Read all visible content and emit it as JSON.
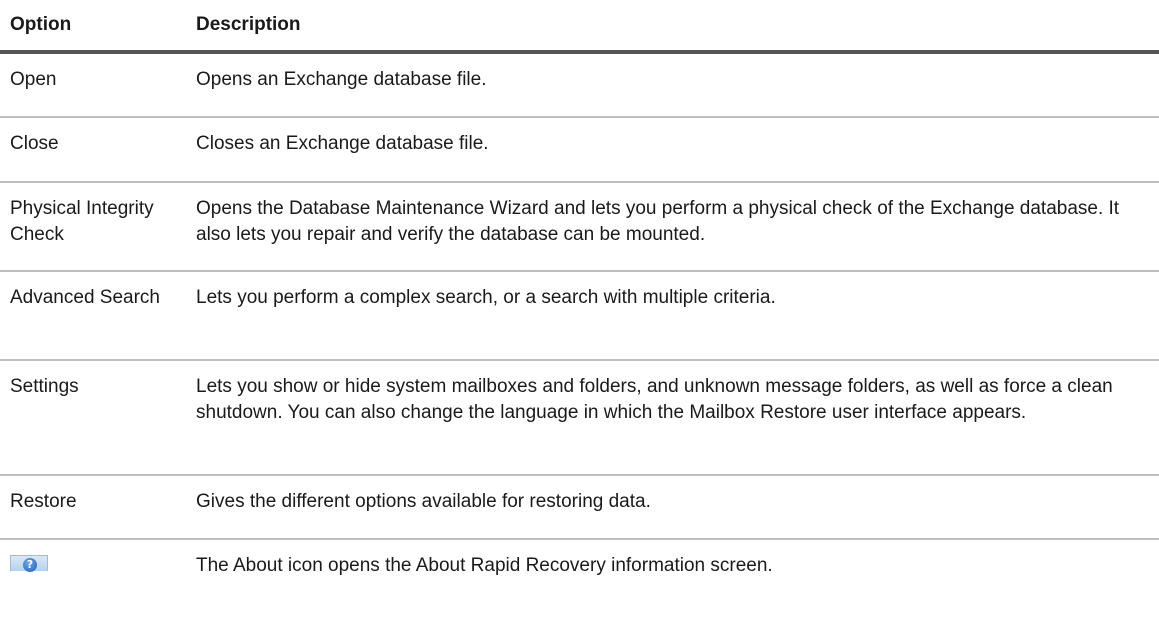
{
  "table": {
    "headers": {
      "option": "Option",
      "description": "Description"
    },
    "rows": [
      {
        "option": "Open",
        "description": "Opens an Exchange database file."
      },
      {
        "option": "Close",
        "description": "Closes an Exchange database file."
      },
      {
        "option": "Physical Integrity Check",
        "description": "Opens the Database Maintenance Wizard and lets you perform a physical check of the Exchange database. It also lets you repair and verify the database can be mounted."
      },
      {
        "option": "Advanced Search",
        "description": "Lets you perform a complex search, or a search with multiple criteria."
      },
      {
        "option": "Settings",
        "description": "Lets you show or hide system mailboxes and folders, and unknown message folders, as well as force a clean shutdown. You can also change the language in which the Mailbox Restore user interface appears."
      },
      {
        "option": "Restore",
        "description": "Gives the different options available for restoring data."
      },
      {
        "option_icon": "help-question-icon",
        "description": "The About icon opens the About Rapid Recovery information screen."
      }
    ]
  }
}
